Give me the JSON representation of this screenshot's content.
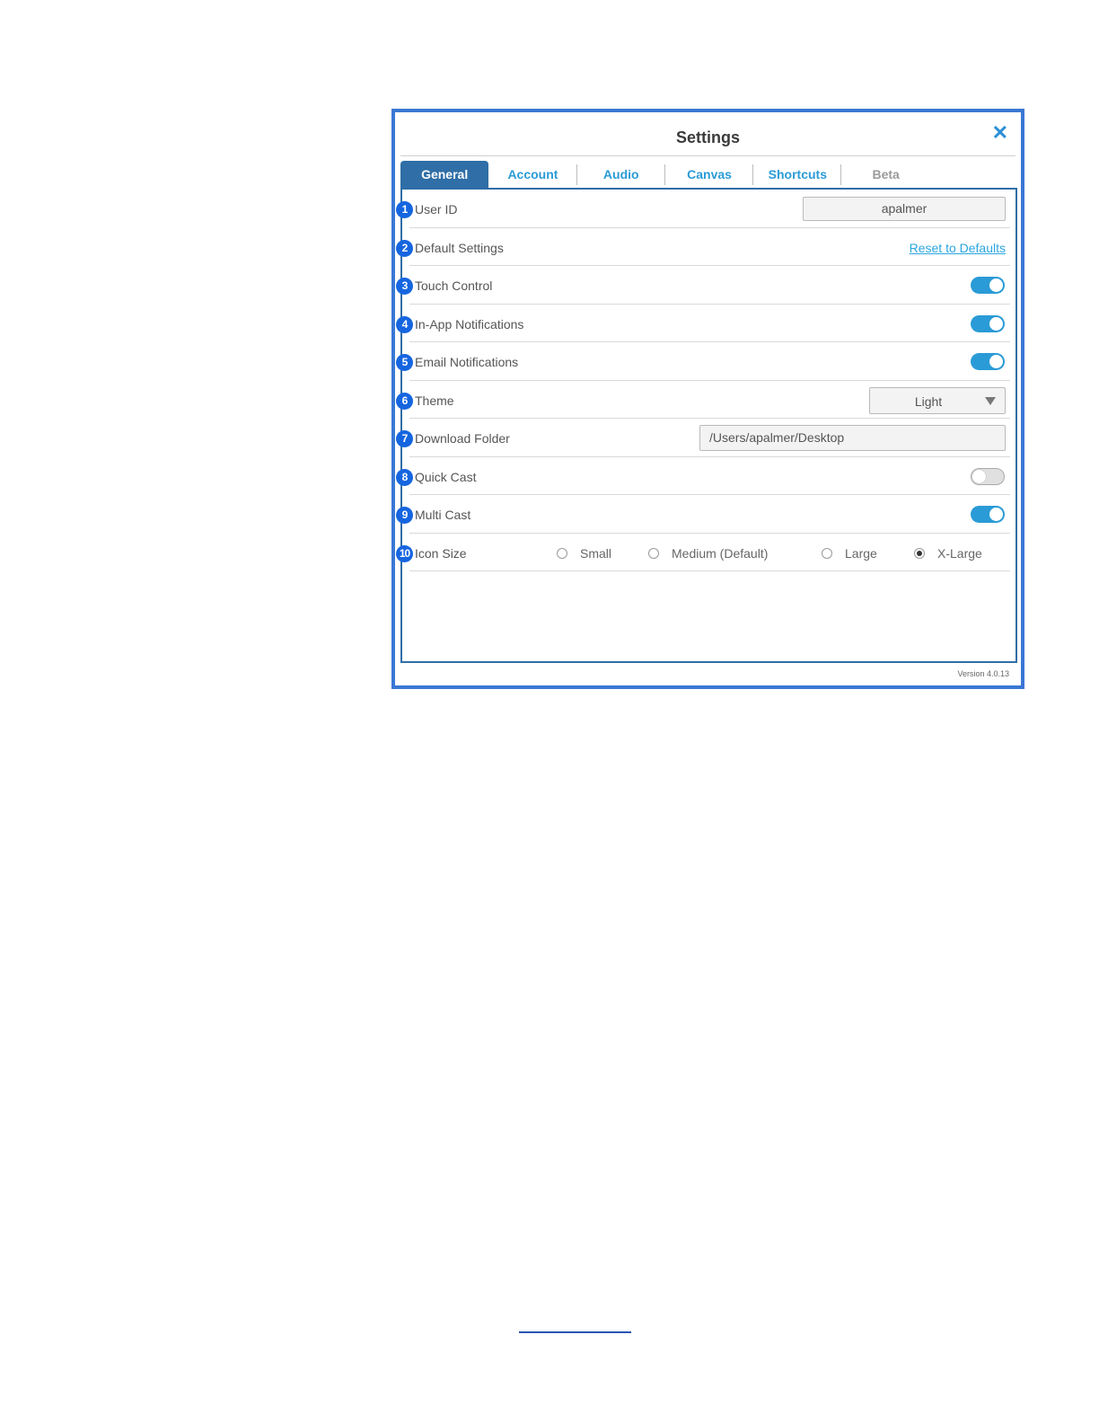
{
  "window": {
    "title": "Settings",
    "close_glyph": "✕",
    "version": "Version 4.0.13"
  },
  "tabs": [
    {
      "label": "General",
      "active": true
    },
    {
      "label": "Account"
    },
    {
      "label": "Audio"
    },
    {
      "label": "Canvas"
    },
    {
      "label": "Shortcuts"
    },
    {
      "label": "Beta",
      "disabled": true
    }
  ],
  "rows": {
    "user_id": {
      "num": "1",
      "label": "User ID",
      "value": "apalmer"
    },
    "default_settings": {
      "num": "2",
      "label": "Default Settings",
      "link": "Reset to Defaults"
    },
    "touch_control": {
      "num": "3",
      "label": "Touch Control",
      "on": true
    },
    "in_app_notifications": {
      "num": "4",
      "label": "In-App Notifications",
      "on": true
    },
    "email_notifications": {
      "num": "5",
      "label": "Email Notifications",
      "on": true
    },
    "theme": {
      "num": "6",
      "label": "Theme",
      "value": "Light"
    },
    "download_folder": {
      "num": "7",
      "label": "Download Folder",
      "value": "/Users/apalmer/Desktop"
    },
    "quick_cast": {
      "num": "8",
      "label": "Quick Cast",
      "on": false
    },
    "multi_cast": {
      "num": "9",
      "label": "Multi Cast",
      "on": true
    },
    "icon_size": {
      "num": "10",
      "label": "Icon Size",
      "options": [
        "Small",
        "Medium (Default)",
        "Large",
        "X-Large"
      ],
      "selected": "X-Large"
    }
  },
  "colors": {
    "accent": "#2a9bd6",
    "frame_border": "#3a78d4",
    "tab_active": "#2f6ea6",
    "badge": "#1565e0"
  }
}
